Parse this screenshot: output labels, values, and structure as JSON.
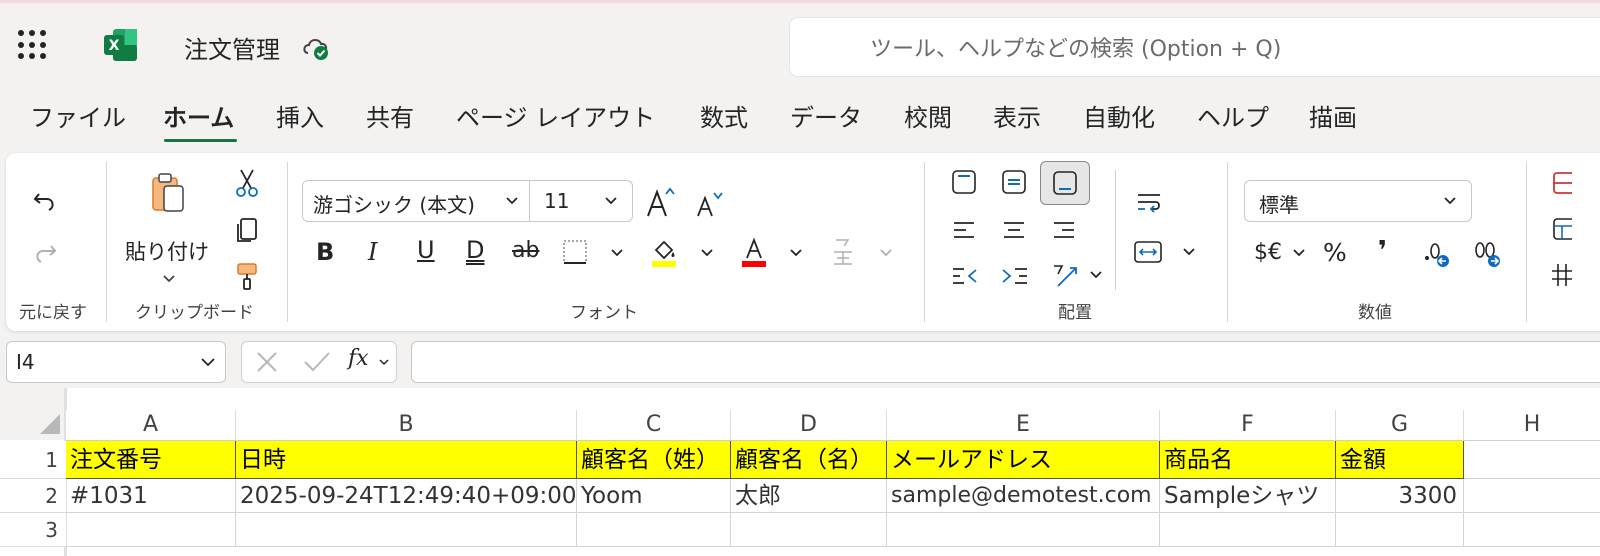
{
  "app": {
    "title": "注文管理",
    "search_placeholder": "ツール、ヘルプなどの検索 (Option + Q)",
    "brand_color": "#107c41"
  },
  "tabs": [
    {
      "label": "ファイル",
      "active": false
    },
    {
      "label": "ホーム",
      "active": true
    },
    {
      "label": "挿入",
      "active": false
    },
    {
      "label": "共有",
      "active": false
    },
    {
      "label": "ページ レイアウト",
      "active": false
    },
    {
      "label": "数式",
      "active": false
    },
    {
      "label": "データ",
      "active": false
    },
    {
      "label": "校閲",
      "active": false
    },
    {
      "label": "表示",
      "active": false
    },
    {
      "label": "自動化",
      "active": false
    },
    {
      "label": "ヘルプ",
      "active": false
    },
    {
      "label": "描画",
      "active": false
    }
  ],
  "ribbon": {
    "undo_group_label": "元に戻す",
    "clipboard_group_label": "クリップボード",
    "paste_label": "貼り付け",
    "font_group_label": "フォント",
    "font_name": "游ゴシック (本文)",
    "font_size": "11",
    "alignment_group_label": "配置",
    "number_group_label": "数値",
    "number_format": "標準",
    "currency_label": "$€",
    "percent_label": "%",
    "comma_label": "❜",
    "highlight_color": "#ffff00",
    "font_color": "#ff0000"
  },
  "formula_bar": {
    "name_box": "I4",
    "fx_label": "fx",
    "formula": ""
  },
  "sheet": {
    "columns": [
      "A",
      "B",
      "C",
      "D",
      "E",
      "F",
      "G",
      "H"
    ],
    "rows": [
      "1",
      "2",
      "3"
    ],
    "header_fill": "#ffff00",
    "header_cells": [
      "注文番号",
      "日時",
      "顧客名（姓）",
      "顧客名（名）",
      "メールアドレス",
      "商品名",
      "金額"
    ],
    "data_cells": [
      "#1031",
      "2025-09-24T12:49:40+09:00",
      "Yoom",
      "太郎",
      "sample@demotest.com",
      "Sampleシャツ",
      "3300"
    ]
  }
}
